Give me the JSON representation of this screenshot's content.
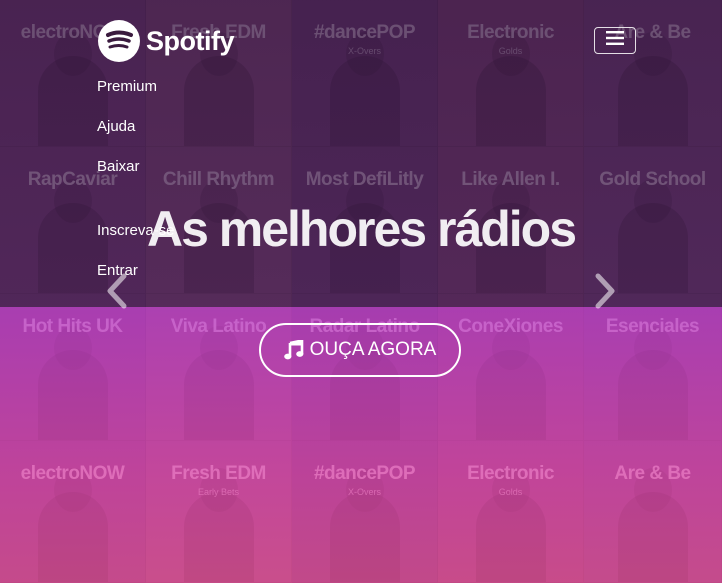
{
  "brand": {
    "name": "Spotify",
    "icon": "spotify-logo-icon",
    "color": "#1db954"
  },
  "nav": {
    "toggle_icon": "hamburger-menu-icon",
    "items": [
      {
        "label": "Premium"
      },
      {
        "label": "Ajuda"
      },
      {
        "label": "Baixar"
      },
      {
        "label": "Inscreva-se"
      },
      {
        "label": "Entrar"
      }
    ]
  },
  "hero": {
    "headline": "As melhores rádios",
    "cta_label": "OUÇA AGORA",
    "cta_icon": "music-note-icon",
    "prev_icon": "chevron-left-icon",
    "next_icon": "chevron-right-icon"
  },
  "playlist_tiles": [
    {
      "title": "electroNOW",
      "sub": ""
    },
    {
      "title": "Fresh EDM",
      "sub": ""
    },
    {
      "title": "#dancePOP",
      "sub": "X-Overs"
    },
    {
      "title": "Electronic",
      "sub": "Golds"
    },
    {
      "title": "Are & Be",
      "sub": ""
    },
    {
      "title": "RapCaviar",
      "sub": ""
    },
    {
      "title": "Chill Rhythm",
      "sub": ""
    },
    {
      "title": "Most DefiLitly",
      "sub": ""
    },
    {
      "title": "Like Allen I.",
      "sub": ""
    },
    {
      "title": "Gold School",
      "sub": ""
    },
    {
      "title": "Hot Hits UK",
      "sub": ""
    },
    {
      "title": "Viva Latino",
      "sub": ""
    },
    {
      "title": "Radar Latino",
      "sub": ""
    },
    {
      "title": "ConeXiones",
      "sub": ""
    },
    {
      "title": "Esenciales",
      "sub": ""
    },
    {
      "title": "electroNOW",
      "sub": ""
    },
    {
      "title": "Fresh EDM",
      "sub": "Early Bets"
    },
    {
      "title": "#dancePOP",
      "sub": "X-Overs"
    },
    {
      "title": "Electronic",
      "sub": "Golds"
    },
    {
      "title": "Are & Be",
      "sub": ""
    }
  ],
  "colors": {
    "tile_palette": [
      "#6a3c6e",
      "#7a4a70",
      "#5e3868",
      "#74406a",
      "#694070"
    ],
    "overlay_top": "#3c1946",
    "overlay_bottom_start": "#ba3ec4",
    "overlay_bottom_end": "#e85096"
  }
}
